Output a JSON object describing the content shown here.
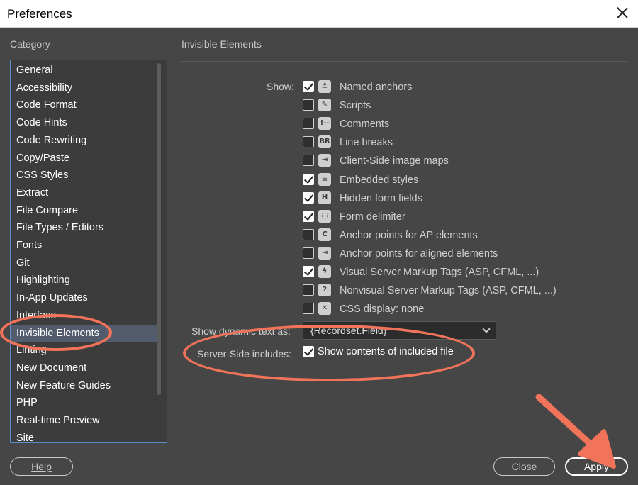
{
  "window": {
    "title": "Preferences"
  },
  "category_label": "Category",
  "section_title": "Invisible Elements",
  "categories": [
    "General",
    "Accessibility",
    "Code Format",
    "Code Hints",
    "Code Rewriting",
    "Copy/Paste",
    "CSS Styles",
    "Extract",
    "File Compare",
    "File Types / Editors",
    "Fonts",
    "Git",
    "Highlighting",
    "In-App Updates",
    "Interface",
    "Invisible Elements",
    "Linting",
    "New Document",
    "New Feature Guides",
    "PHP",
    "Real-time Preview",
    "Site"
  ],
  "selected_category": "Invisible Elements",
  "show_label": "Show:",
  "show_items": [
    {
      "label": "Named anchors",
      "checked": true,
      "icon": "anchor-icon",
      "glyph": "⚓"
    },
    {
      "label": "Scripts",
      "checked": false,
      "icon": "script-icon",
      "glyph": "✎"
    },
    {
      "label": "Comments",
      "checked": false,
      "icon": "comment-icon",
      "glyph": "!--"
    },
    {
      "label": "Line breaks",
      "checked": false,
      "icon": "line-break-icon",
      "glyph": "BR"
    },
    {
      "label": "Client-Side image maps",
      "checked": false,
      "icon": "image-map-icon",
      "glyph": "⇥"
    },
    {
      "label": "Embedded styles",
      "checked": true,
      "icon": "style-icon",
      "glyph": "≡"
    },
    {
      "label": "Hidden form fields",
      "checked": true,
      "icon": "hidden-field-icon",
      "glyph": "H"
    },
    {
      "label": "Form delimiter",
      "checked": true,
      "icon": "form-delimiter-icon",
      "glyph": "⬚"
    },
    {
      "label": "Anchor points for AP elements",
      "checked": false,
      "icon": "ap-anchor-icon",
      "glyph": "C"
    },
    {
      "label": "Anchor points for aligned elements",
      "checked": false,
      "icon": "aligned-anchor-icon",
      "glyph": "⇥"
    },
    {
      "label": "Visual Server Markup Tags (ASP, CFML, ...)",
      "checked": true,
      "icon": "server-tag-icon",
      "glyph": "ϟ"
    },
    {
      "label": "Nonvisual Server Markup Tags (ASP, CFML, ...)",
      "checked": false,
      "icon": "nonvisual-tag-icon",
      "glyph": "?"
    },
    {
      "label": "CSS display: none",
      "checked": false,
      "icon": "display-none-icon",
      "glyph": "✕"
    }
  ],
  "dynamic_text": {
    "label": "Show dynamic text as:",
    "value": "{Recordset.Field}"
  },
  "server_side": {
    "label": "Server-Side includes:",
    "option_label": "Show contents of included file",
    "checked": true
  },
  "buttons": {
    "help": "Help",
    "close": "Close",
    "apply": "Apply"
  },
  "colors": {
    "dialog_bg": "#464646",
    "selection": "#525c6c",
    "focus_border": "#5b8fc9",
    "annotation": "#f0735a"
  }
}
